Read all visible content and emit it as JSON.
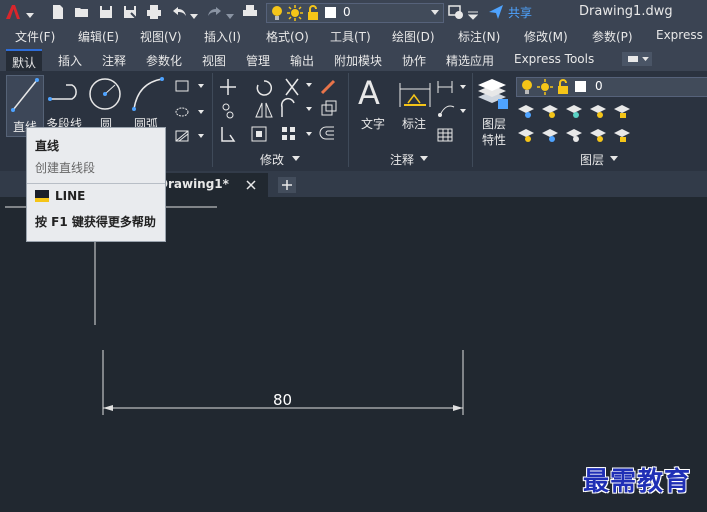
{
  "app": {
    "title": "Drawing1.dwg",
    "share_label": "共享",
    "layer_combo_value": "0"
  },
  "menubar": {
    "items": [
      "文件(F)",
      "编辑(E)",
      "视图(V)",
      "插入(I)",
      "格式(O)",
      "工具(T)",
      "绘图(D)",
      "标注(N)",
      "修改(M)",
      "参数(P)",
      "Express"
    ]
  },
  "tabs": {
    "items": [
      "默认",
      "插入",
      "注释",
      "参数化",
      "视图",
      "管理",
      "输出",
      "附加模块",
      "协作",
      "精选应用",
      "Express Tools"
    ],
    "active": "默认"
  },
  "ribbon": {
    "draw": {
      "line": "直线",
      "polyline": "多段线",
      "circle": "圆",
      "arc": "圆弧"
    },
    "modify_title": "修改",
    "annotation": {
      "text": "文字",
      "dimension": "标注",
      "title": "注释"
    },
    "layers": {
      "properties_line1": "图层",
      "properties_line2": "特性",
      "title": "图层",
      "combo_value": "0"
    }
  },
  "doc_tab": {
    "label": "Drawing1*"
  },
  "tooltip": {
    "title": "直线",
    "description": "创建直线段",
    "command": "LINE",
    "help": "按 F1 键获得更多帮助"
  },
  "drawing": {
    "dimension_text": "80"
  },
  "watermark": "最需教育",
  "colors": {
    "accent": "#2e6dd8",
    "canvas_bg": "#212830",
    "ribbon_bg": "#2b3340",
    "menubar_bg": "#3b4453",
    "tooltip_bg": "#e9ebee",
    "watermark": "#1f2fb5",
    "app_red": "#d8262c"
  }
}
